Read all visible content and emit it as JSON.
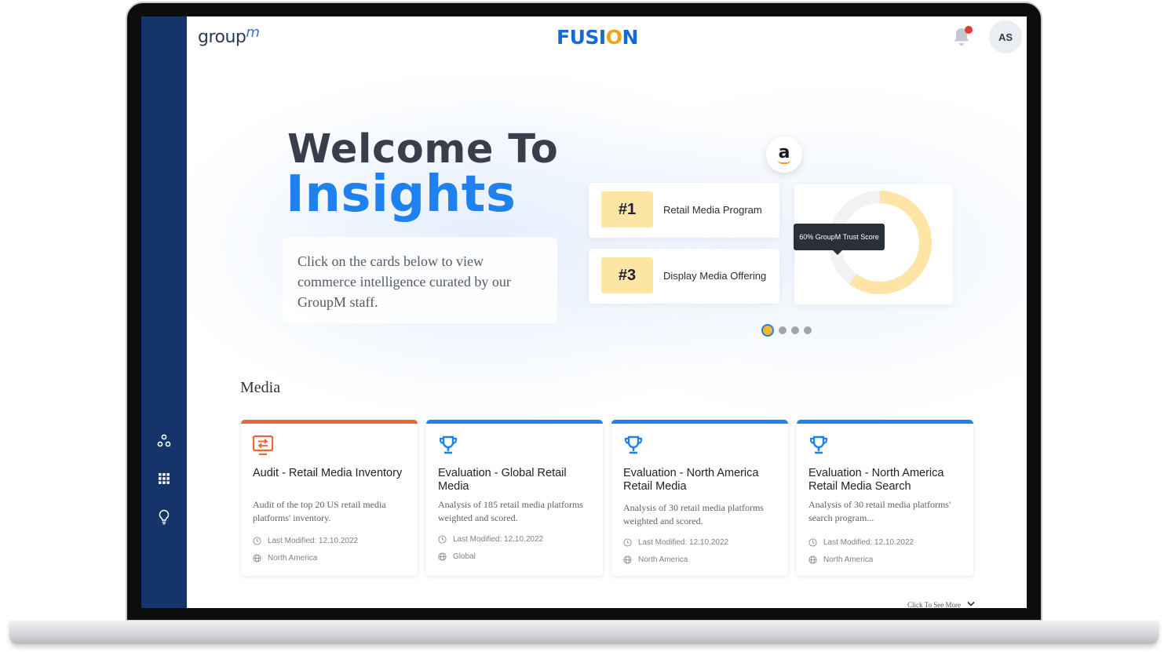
{
  "header": {
    "logo_left_text": "group",
    "logo_left_superscript": "m",
    "logo_center_prefix": "FUSI",
    "logo_center_o": "O",
    "logo_center_suffix": "N",
    "avatar_initials": "AS",
    "notification_icon": "bell-icon"
  },
  "sidebar": {
    "items": [
      {
        "icon": "nodes-icon"
      },
      {
        "icon": "grid-icon"
      },
      {
        "icon": "lightbulb-icon"
      }
    ]
  },
  "hero": {
    "title_line1": "Welcome To",
    "title_line2": "Insights",
    "description": "Click on the cards below to view commerce intelligence curated by our GroupM staff.",
    "brand_badge": "a",
    "rankings": [
      {
        "rank": "#1",
        "label": "Retail Media Program"
      },
      {
        "rank": "#3",
        "label": "Display Media Offering"
      }
    ],
    "trust_score": {
      "tooltip": "60% GroupM Trust Score",
      "value_percent": 60
    },
    "carousel": {
      "count": 4,
      "active_index": 0
    }
  },
  "media": {
    "section_title": "Media",
    "cards": [
      {
        "icon": "monitor-transfer-icon",
        "title": "Audit - Retail Media Inventory",
        "description": "Audit of the top 20 US retail media platforms' inventory.",
        "modified": "Last Modified: 12.10.2022",
        "region": "North America"
      },
      {
        "icon": "trophy-icon",
        "title": "Evaluation - Global Retail Media",
        "description": "Analysis of 185 retail media platforms weighted and scored.",
        "modified": "Last Modified: 12.10.2022",
        "region": "Global"
      },
      {
        "icon": "trophy-icon",
        "title": "Evaluation - North America Retail Media",
        "description": "Analysis of 30 retail media platforms weighted and scored.",
        "modified": "Last Modified: 12.10.2022",
        "region": "North America"
      },
      {
        "icon": "trophy-icon",
        "title": "Evaluation - North America Retail Media Search",
        "description": "Analysis of 30 retail media platforms' search program...",
        "modified": "Last Modified: 12.10.2022",
        "region": "North America"
      }
    ],
    "see_more": "Click To See More"
  },
  "colors": {
    "sidebar": "#15346a",
    "accent_blue": "#1f80f0",
    "accent_orange": "#ec6535",
    "rank_highlight": "#fde6a5",
    "donut_fill": "#fde6a5"
  }
}
